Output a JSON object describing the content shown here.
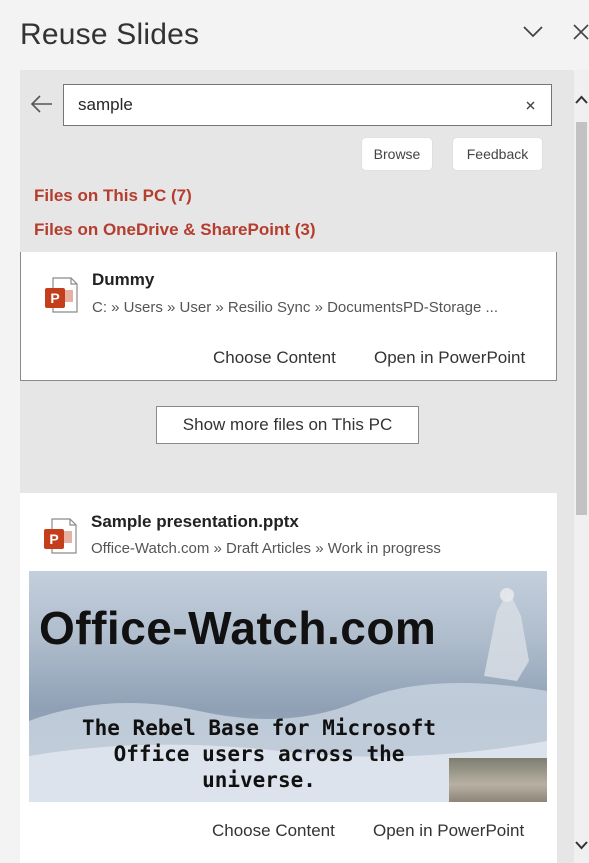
{
  "pane": {
    "title": "Reuse Slides"
  },
  "search": {
    "value": "sample",
    "browse_label": "Browse",
    "feedback_label": "Feedback"
  },
  "filters": {
    "this_pc": "Files on This PC (7)",
    "onedrive": "Files on OneDrive & SharePoint (3)"
  },
  "results": [
    {
      "name": "Dummy",
      "path": "C: » Users » User » Resilio Sync » DocumentsPD-Storage ...",
      "choose_label": "Choose Content",
      "open_label": "Open in PowerPoint"
    },
    {
      "name": "Sample presentation.pptx",
      "path": "Office-Watch.com » Draft Articles » Work in progress",
      "choose_label": "Choose Content",
      "open_label": "Open in PowerPoint",
      "thumbnail": {
        "title": "Office-Watch.com",
        "subtitle_line1": "The Rebel Base for Microsoft",
        "subtitle_line2": "Office users across the universe."
      }
    }
  ],
  "show_more_label": "Show more files on This PC",
  "colors": {
    "link": "#b53d2e",
    "pane_bg": "#e6e6e6",
    "powerpoint": "#c43e1c"
  },
  "icons": {
    "collapse": "chevron-down-icon",
    "close": "close-icon",
    "back": "back-arrow-icon",
    "clear": "clear-icon",
    "file": "powerpoint-file-icon"
  }
}
